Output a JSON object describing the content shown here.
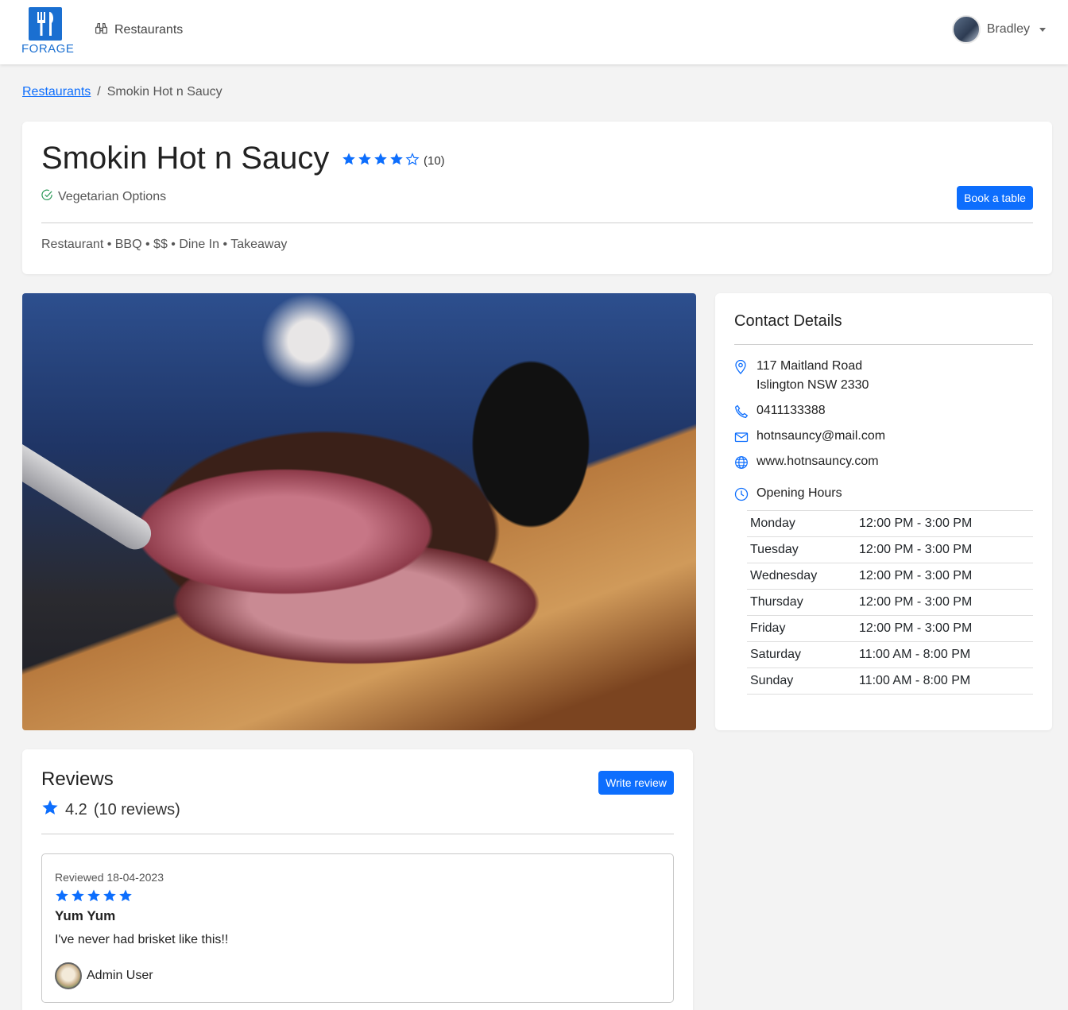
{
  "nav": {
    "logo_text": "FORAGE",
    "link_label": "Restaurants",
    "user_name": "Bradley"
  },
  "breadcrumb": {
    "parent": "Restaurants",
    "separator": "/",
    "current": "Smokin Hot n Saucy"
  },
  "restaurant": {
    "name": "Smokin Hot n Saucy",
    "rating_count": "(10)",
    "stars_filled": 4,
    "stars_total": 5,
    "vegetarian_label": "Vegetarian Options",
    "book_label": "Book a table",
    "tags": "Restaurant • BBQ • $$ • Dine In • Takeaway"
  },
  "contact": {
    "title": "Contact Details",
    "address_line1": "117 Maitland Road",
    "address_line2": "Islington NSW 2330",
    "phone": "0411133388",
    "email": "hotnsauncy@mail.com",
    "website": "www.hotnsauncy.com",
    "hours_title": "Opening Hours",
    "hours": [
      {
        "day": "Monday",
        "time": "12:00 PM - 3:00 PM"
      },
      {
        "day": "Tuesday",
        "time": "12:00 PM - 3:00 PM"
      },
      {
        "day": "Wednesday",
        "time": "12:00 PM - 3:00 PM"
      },
      {
        "day": "Thursday",
        "time": "12:00 PM - 3:00 PM"
      },
      {
        "day": "Friday",
        "time": "12:00 PM - 3:00 PM"
      },
      {
        "day": "Saturday",
        "time": "11:00 AM - 8:00 PM"
      },
      {
        "day": "Sunday",
        "time": "11:00 AM - 8:00 PM"
      }
    ]
  },
  "reviews": {
    "title": "Reviews",
    "average": "4.2",
    "count_label": "(10 reviews)",
    "write_label": "Write review",
    "items": [
      {
        "date": "Reviewed 18-04-2023",
        "stars": 5,
        "title": "Yum Yum",
        "body": "I've never had brisket like this!!",
        "user": "Admin User"
      }
    ]
  },
  "colors": {
    "accent": "#0d6efd",
    "star": "#0d6efd",
    "veg_check": "#2e9a5a",
    "background": "#f3f3f3"
  }
}
